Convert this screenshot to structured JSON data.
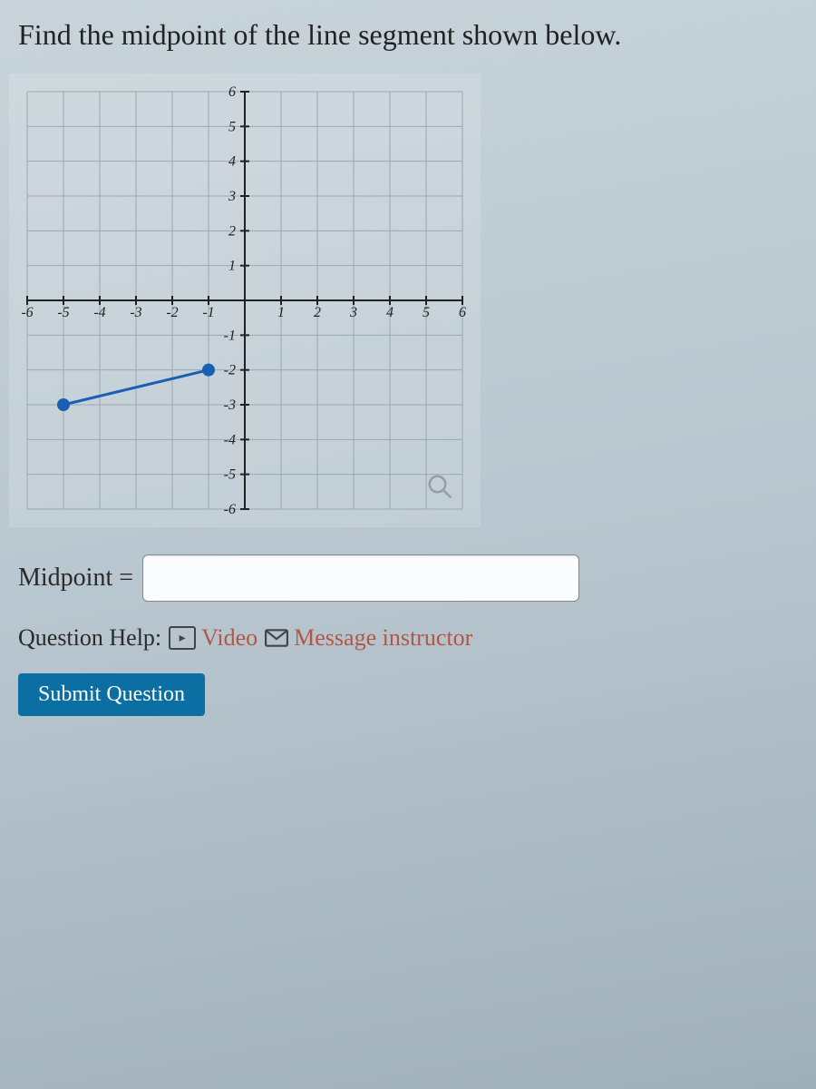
{
  "question": {
    "prompt": "Find the midpoint of the line segment shown below."
  },
  "chart_data": {
    "type": "scatter",
    "title": "",
    "xlabel": "",
    "ylabel": "",
    "xlim": [
      -6,
      6
    ],
    "ylim": [
      -6,
      6
    ],
    "x_ticks": [
      -6,
      -5,
      -4,
      -3,
      -2,
      -1,
      1,
      2,
      3,
      4,
      5,
      6
    ],
    "y_ticks": [
      6,
      5,
      4,
      3,
      2,
      1,
      -1,
      -2,
      -3,
      -4,
      -5,
      -6
    ],
    "segment": {
      "p1": {
        "x": -5,
        "y": -3
      },
      "p2": {
        "x": -1,
        "y": -2
      }
    }
  },
  "answer": {
    "label": "Midpoint =",
    "value": ""
  },
  "help": {
    "label": "Question Help:",
    "video_label": "Video",
    "message_label": "Message instructor"
  },
  "actions": {
    "submit_label": "Submit Question"
  }
}
